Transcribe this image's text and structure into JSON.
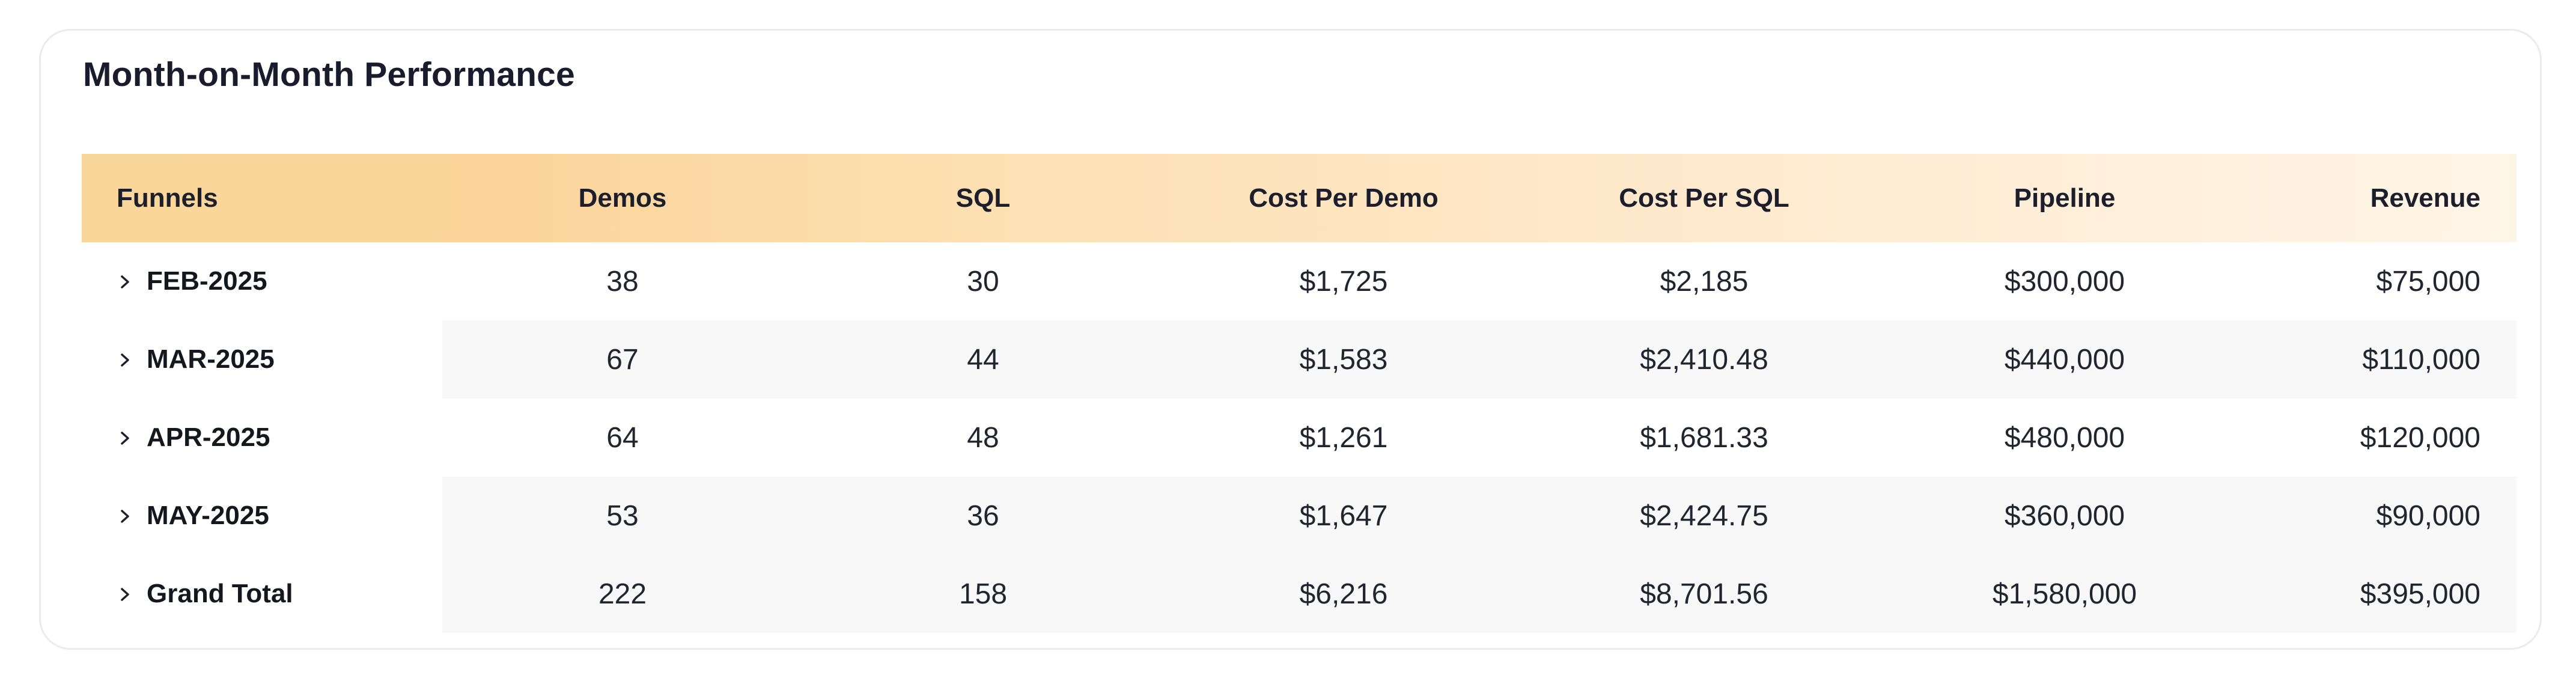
{
  "card": {
    "title": "Month-on-Month Performance"
  },
  "table": {
    "headers": [
      "Funnels",
      "Demos",
      "SQL",
      "Cost Per Demo",
      "Cost Per SQL",
      "Pipeline",
      "Revenue"
    ],
    "rows": [
      {
        "funnel": "FEB-2025",
        "demos": "38",
        "sql": "30",
        "cost_per_demo": "$1,725",
        "cost_per_sql": "$2,185",
        "pipeline": "$300,000",
        "revenue": "$75,000"
      },
      {
        "funnel": "MAR-2025",
        "demos": "67",
        "sql": "44",
        "cost_per_demo": "$1,583",
        "cost_per_sql": "$2,410.48",
        "pipeline": "$440,000",
        "revenue": "$110,000"
      },
      {
        "funnel": "APR-2025",
        "demos": "64",
        "sql": "48",
        "cost_per_demo": "$1,261",
        "cost_per_sql": "$1,681.33",
        "pipeline": "$480,000",
        "revenue": "$120,000"
      },
      {
        "funnel": "MAY-2025",
        "demos": "53",
        "sql": "36",
        "cost_per_demo": "$1,647",
        "cost_per_sql": "$2,424.75",
        "pipeline": "$360,000",
        "revenue": "$90,000"
      },
      {
        "funnel": "Grand Total",
        "demos": "222",
        "sql": "158",
        "cost_per_demo": "$6,216",
        "cost_per_sql": "$8,701.56",
        "pipeline": "$1,580,000",
        "revenue": "$395,000"
      }
    ]
  },
  "icons": {
    "expand": "chevron-right-icon"
  },
  "colors": {
    "header_gradient_start": "#f9d79a",
    "header_gradient_end": "#fff5e7",
    "row_shade": "#f8f8f9",
    "card_border": "#ebebef"
  }
}
